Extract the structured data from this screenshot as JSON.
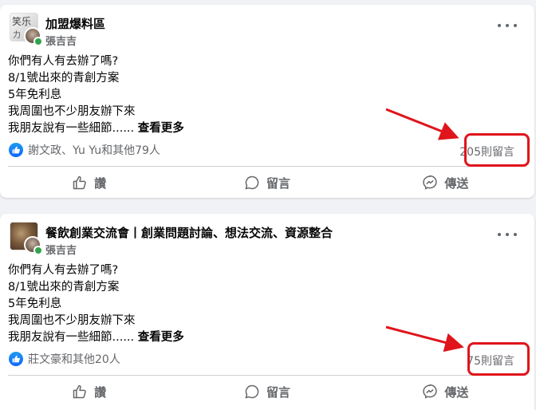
{
  "posts": [
    {
      "group_name": "加盟爆料區",
      "author": "張吉吉",
      "text_lines": [
        "你們有人有去辦了嗎?",
        "8/1號出來的青創方案",
        "5年免利息",
        "我周圍也不少朋友辦下來",
        "我朋友說有一些細節......"
      ],
      "see_more": "查看更多",
      "reactions": "謝文政、Yu Yu和其他79人",
      "comments": "205則留言",
      "avatar_text": "笑乐",
      "avatar_text2": "力"
    },
    {
      "group_name": "餐飲創業交流會丨創業問題討論、想法交流、資源整合",
      "author": "張吉吉",
      "text_lines": [
        "你們有人有去辦了嗎?",
        "8/1號出來的青創方案",
        "5年免利息",
        "我周圍也不少朋友辦下來",
        "我朋友說有一些細節......"
      ],
      "see_more": "查看更多",
      "reactions": "莊文豪和其他20人",
      "comments": "75則留言"
    }
  ],
  "actions": {
    "like": "讚",
    "comment": "留言",
    "share": "傳送"
  },
  "colors": {
    "accent": "#1877f2",
    "highlight": "#e0141b",
    "online": "#31a24c",
    "secondary_text": "#65676b"
  },
  "icons": [
    "more-icon",
    "like-icon",
    "comment-icon",
    "messenger-icon",
    "like-reaction-icon"
  ]
}
